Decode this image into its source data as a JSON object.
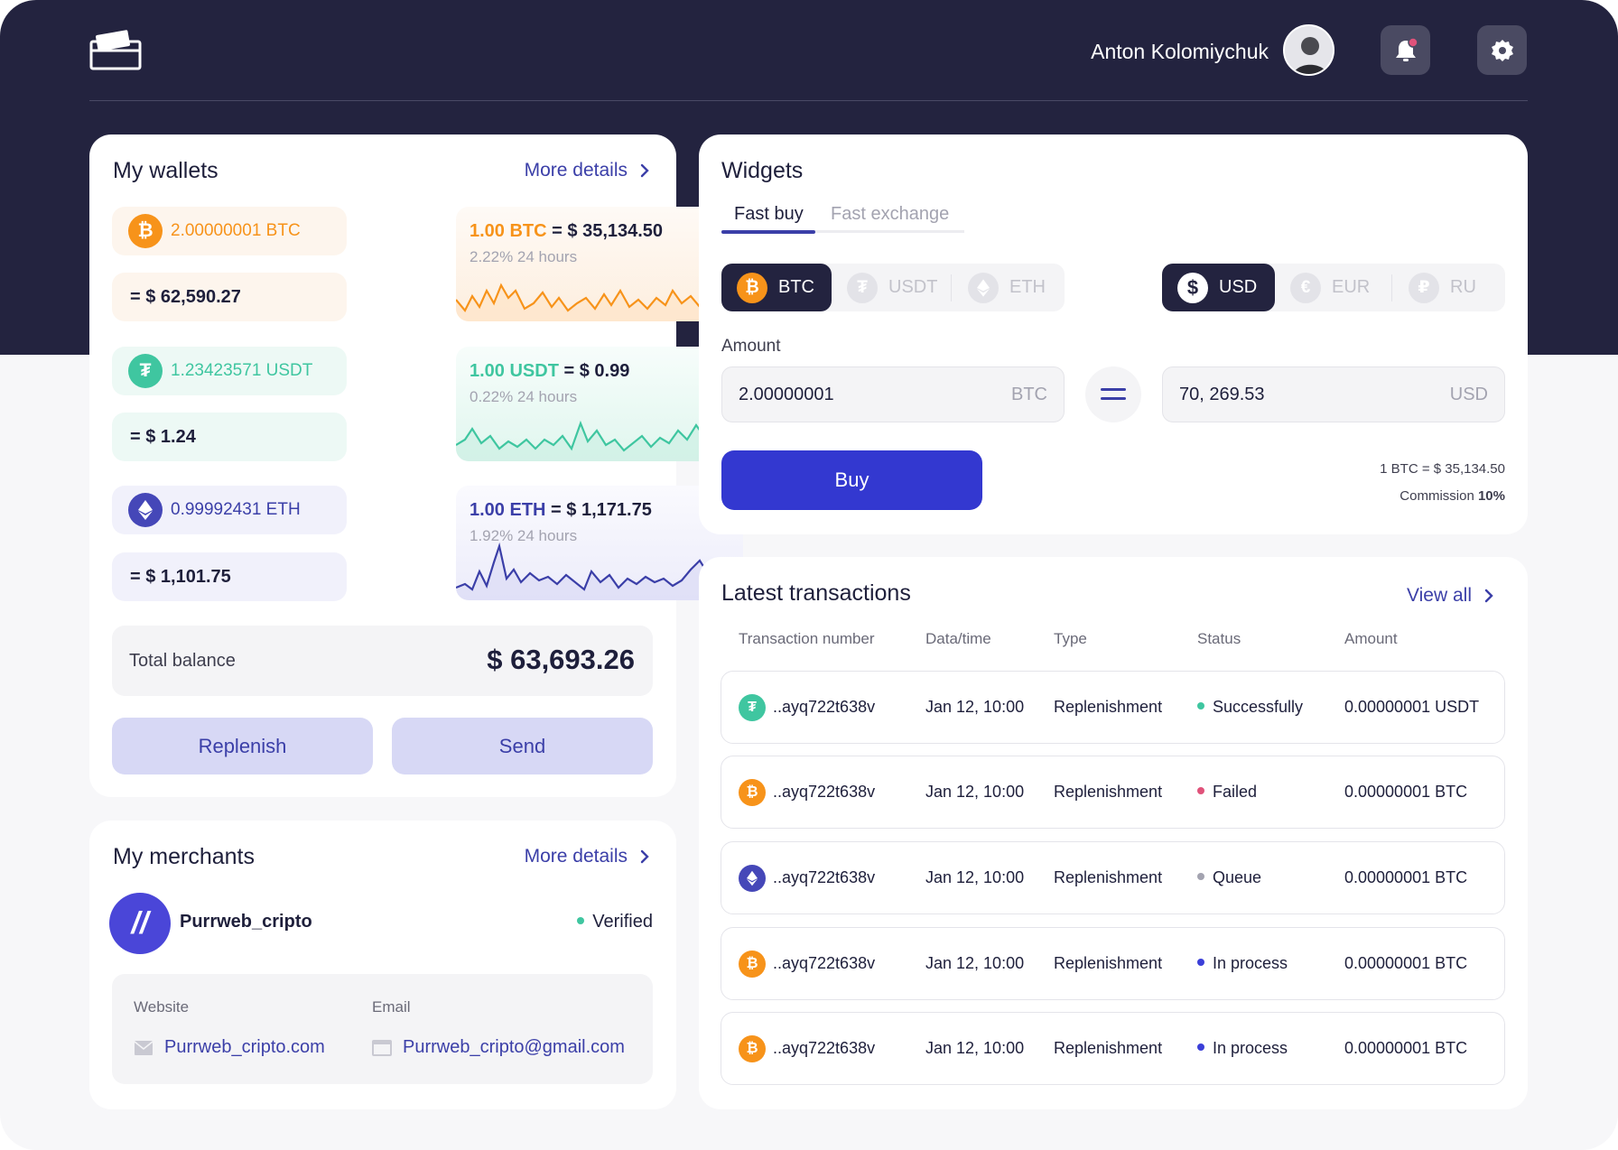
{
  "header": {
    "user_name": "Anton Kolomiychuk"
  },
  "colors": {
    "navy": "#23233f",
    "accent": "#3b3fa8",
    "primary_button": "#3338d0",
    "btc": "#f7931a",
    "usdt": "#3fc6a0",
    "eth": "#4547b8",
    "success": "#3fc6a0",
    "failed": "#e0527a",
    "queue": "#a3a3b0",
    "in_process": "#3b3fd8"
  },
  "wallets": {
    "title": "My wallets",
    "more_label": "More details",
    "items": [
      {
        "coin": "btc",
        "icon": "bitcoin-icon",
        "amount": "2.00000001 BTC",
        "usd": "= $ 62,590.27",
        "rate_coin": "1.00 BTC",
        "rate_value": "= $ 35,134.50",
        "change": "2.22% 24 hours"
      },
      {
        "coin": "usdt",
        "icon": "tether-icon",
        "amount": "1.23423571 USDT",
        "usd": "= $ 1.24",
        "rate_coin": "1.00 USDT",
        "rate_value": "= $ 0.99",
        "change": "0.22% 24 hours"
      },
      {
        "coin": "eth",
        "icon": "ethereum-icon",
        "amount": "0.99992431 ETH",
        "usd": "= $ 1,101.75",
        "rate_coin": "1.00 ETH",
        "rate_value": "= $ 1,171.75",
        "change": "1.92% 24 hours"
      }
    ],
    "total_label": "Total balance",
    "total_value": "$ 63,693.26",
    "replenish_label": "Replenish",
    "send_label": "Send"
  },
  "merchants": {
    "title": "My merchants",
    "more_label": "More details",
    "name": "Purrweb_cripto",
    "logo_text": "//",
    "status": "Verified",
    "website_label": "Website",
    "website_value": "Purrweb_cripto.com",
    "email_label": "Email",
    "email_value": "Purrweb_cripto@gmail.com"
  },
  "widgets": {
    "title": "Widgets",
    "tabs": [
      {
        "label": "Fast buy",
        "active": true
      },
      {
        "label": "Fast exchange",
        "active": false
      }
    ],
    "coins": [
      {
        "label": "BTC",
        "icon": "bitcoin-icon",
        "active": true
      },
      {
        "label": "USDT",
        "icon": "tether-icon",
        "active": false
      },
      {
        "label": "ETH",
        "icon": "ethereum-icon",
        "active": false
      }
    ],
    "currencies": [
      {
        "label": "USD",
        "icon": "dollar-icon",
        "active": true
      },
      {
        "label": "EUR",
        "icon": "euro-icon",
        "active": false
      },
      {
        "label": "RU",
        "icon": "ruble-icon",
        "active": false
      }
    ],
    "amount_label": "Amount",
    "amount_value": "2.00000001",
    "amount_unit": "BTC",
    "result_value": "70, 269.53",
    "result_unit": "USD",
    "buy_label": "Buy",
    "rate_text": "1 BTC =  $ 35,134.50",
    "commission_label": "Commission",
    "commission_value": "10%"
  },
  "transactions": {
    "title": "Latest transactions",
    "view_all_label": "View all",
    "headers": [
      "Transaction number",
      "Data/time",
      "Type",
      "Status",
      "Amount"
    ],
    "rows": [
      {
        "icon": "tether-icon",
        "coin": "usdt",
        "number": "..ayq722t638v",
        "datetime": "Jan 12, 10:00",
        "type": "Replenishment",
        "status": "Successfully",
        "status_key": "success",
        "amount": "0.00000001 USDT"
      },
      {
        "icon": "bitcoin-icon",
        "coin": "btc",
        "number": "..ayq722t638v",
        "datetime": "Jan 12, 10:00",
        "type": "Replenishment",
        "status": "Failed",
        "status_key": "failed",
        "amount": "0.00000001 BTC"
      },
      {
        "icon": "ethereum-icon",
        "coin": "eth",
        "number": "..ayq722t638v",
        "datetime": "Jan 12, 10:00",
        "type": "Replenishment",
        "status": "Queue",
        "status_key": "queue",
        "amount": "0.00000001 BTC"
      },
      {
        "icon": "bitcoin-icon",
        "coin": "btc",
        "number": "..ayq722t638v",
        "datetime": "Jan 12, 10:00",
        "type": "Replenishment",
        "status": "In process",
        "status_key": "in_process",
        "amount": "0.00000001 BTC"
      },
      {
        "icon": "bitcoin-icon",
        "coin": "btc",
        "number": "..ayq722t638v",
        "datetime": "Jan 12, 10:00",
        "type": "Replenishment",
        "status": "In process",
        "status_key": "in_process",
        "amount": "0.00000001 BTC"
      }
    ]
  }
}
